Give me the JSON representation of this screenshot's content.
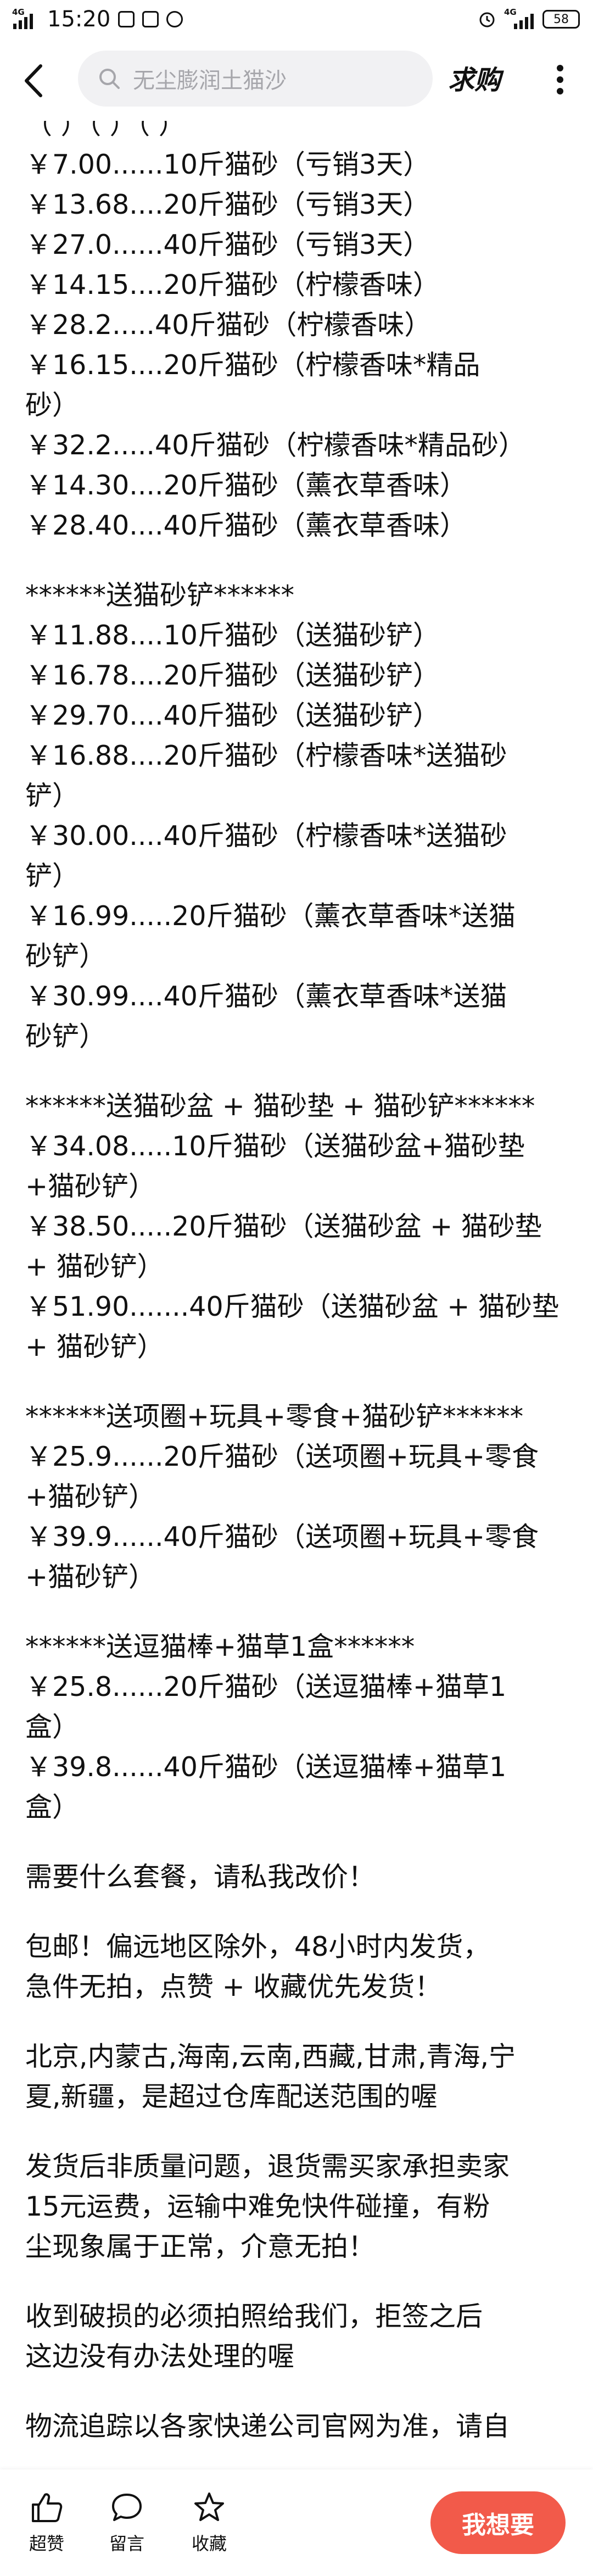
{
  "status_bar": {
    "network_left": "4G",
    "time": "15:20",
    "network_right": "4G",
    "battery": "58"
  },
  "header": {
    "search_placeholder": "无尘膨润土猫沙",
    "qiugou": "求购"
  },
  "content": {
    "top_partial": "（ ）（ ）（ ）",
    "block1": [
      "￥7.00......10斤猫砂（亏销3天）",
      "￥13.68....20斤猫砂（亏销3天）",
      "￥27.0......40斤猫砂（亏销3天）",
      "￥14.15....20斤猫砂（柠檬香味）",
      "￥28.2.....40斤猫砂（柠檬香味）",
      "￥16.15....20斤猫砂（柠檬香味*精品",
      "砂）",
      "￥32.2.....40斤猫砂（柠檬香味*精品砂）",
      "￥14.30....20斤猫砂（薰衣草香味）",
      "￥28.40....40斤猫砂（薰衣草香味）"
    ],
    "block2": [
      "******送猫砂铲******",
      "￥11.88....10斤猫砂（送猫砂铲）",
      "￥16.78....20斤猫砂（送猫砂铲）",
      "￥29.70....40斤猫砂（送猫砂铲）",
      "￥16.88....20斤猫砂（柠檬香味*送猫砂",
      "铲）",
      "￥30.00....40斤猫砂（柠檬香味*送猫砂",
      "铲）",
      "￥16.99.....20斤猫砂（薰衣草香味*送猫",
      "砂铲）",
      "￥30.99....40斤猫砂（薰衣草香味*送猫",
      "砂铲）"
    ],
    "block3": [
      "******送猫砂盆 + 猫砂垫 + 猫砂铲******",
      "￥34.08.....10斤猫砂（送猫砂盆+猫砂垫",
      "+猫砂铲）",
      "￥38.50.....20斤猫砂（送猫砂盆 + 猫砂垫",
      " + 猫砂铲）",
      "￥51.90.......40斤猫砂（送猫砂盆 + 猫砂垫",
      " + 猫砂铲）"
    ],
    "block4": [
      "******送项圈+玩具+零食+猫砂铲******",
      "￥25.9......20斤猫砂（送项圈+玩具+零食",
      "+猫砂铲）",
      "￥39.9......40斤猫砂（送项圈+玩具+零食",
      "+猫砂铲）"
    ],
    "block5": [
      "******送逗猫棒+猫草1盒******",
      "￥25.8......20斤猫砂（送逗猫棒+猫草1",
      "盒）",
      "￥39.8......40斤猫砂（送逗猫棒+猫草1",
      "盒）"
    ],
    "paragraphs": [
      [
        "需要什么套餐，请私我改价！"
      ],
      [
        "包邮！偏远地区除外，48小时内发货，",
        "急件无拍，点赞 + 收藏优先发货！"
      ],
      [
        "北京,内蒙古,海南,云南,西藏,甘肃,青海,宁",
        "夏,新疆，是超过仓库配送范围的喔"
      ],
      [
        "发货后非质量问题，退货需买家承担卖家",
        "15元运费，运输中难免快件碰撞，有粉",
        "尘现象属于正常，介意无拍！"
      ],
      [
        "收到破损的必须拍照给我们，拒签之后",
        "这边没有办法处理的喔"
      ],
      [
        "物流追踪以各家快递公司官网为准，请自"
      ]
    ]
  },
  "bottom_bar": {
    "like_label": "超赞",
    "comment_label": "留言",
    "favorite_label": "收藏",
    "want_label": "我想要"
  },
  "colors": {
    "accent": "#f25a4a",
    "search_bg": "#f1f1f3",
    "placeholder": "#a6a6ab"
  }
}
